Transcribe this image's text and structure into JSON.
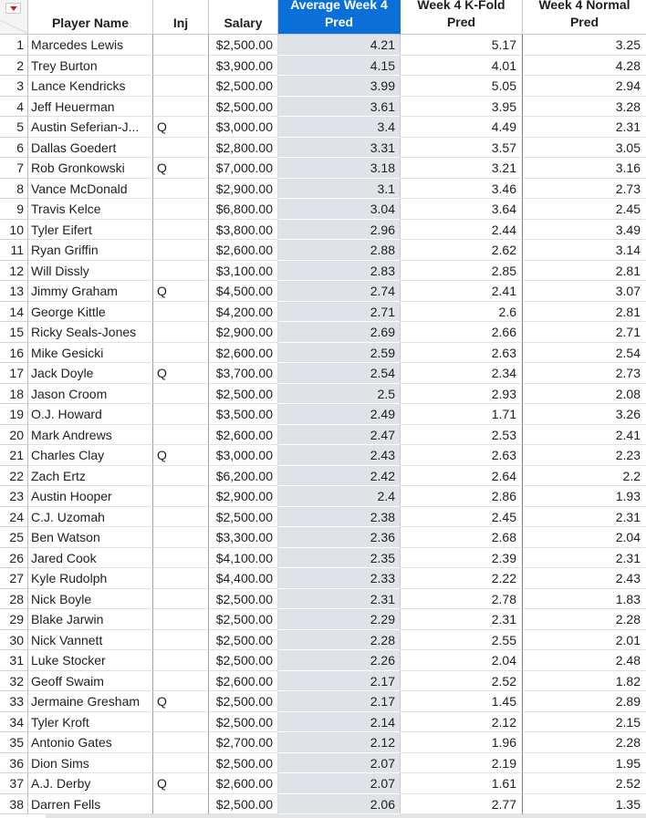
{
  "table": {
    "menu_icon": "red-triangle-menu-icon",
    "columns": [
      {
        "key": "name",
        "label": "Player Name"
      },
      {
        "key": "inj",
        "label": "Inj"
      },
      {
        "key": "salary",
        "label": "Salary"
      },
      {
        "key": "avg",
        "label": "Average Week 4 Pred",
        "selected": true
      },
      {
        "key": "kfold",
        "label": "Week 4 K-Fold Pred"
      },
      {
        "key": "normal",
        "label": "Week 4 Normal Pred"
      }
    ],
    "header_lines": {
      "name": [
        "Player Name"
      ],
      "inj": [
        "Inj"
      ],
      "salary": [
        "Salary"
      ],
      "avg": [
        "Average Week 4",
        "Pred"
      ],
      "kfold": [
        "Week 4 K-Fold",
        "Pred"
      ],
      "normal": [
        "Week 4 Normal",
        "Pred"
      ]
    },
    "selected_column_color": "#0a6fd8",
    "rows": [
      {
        "n": "1",
        "name": "Marcedes Lewis",
        "inj": "",
        "salary": "$2,500.00",
        "avg": "4.21",
        "kfold": "5.17",
        "normal": "3.25"
      },
      {
        "n": "2",
        "name": "Trey Burton",
        "inj": "",
        "salary": "$3,900.00",
        "avg": "4.15",
        "kfold": "4.01",
        "normal": "4.28"
      },
      {
        "n": "3",
        "name": "Lance Kendricks",
        "inj": "",
        "salary": "$2,500.00",
        "avg": "3.99",
        "kfold": "5.05",
        "normal": "2.94"
      },
      {
        "n": "4",
        "name": "Jeff Heuerman",
        "inj": "",
        "salary": "$2,500.00",
        "avg": "3.61",
        "kfold": "3.95",
        "normal": "3.28"
      },
      {
        "n": "5",
        "name": "Austin Seferian-J...",
        "inj": "Q",
        "salary": "$3,000.00",
        "avg": "3.4",
        "kfold": "4.49",
        "normal": "2.31"
      },
      {
        "n": "6",
        "name": "Dallas Goedert",
        "inj": "",
        "salary": "$2,800.00",
        "avg": "3.31",
        "kfold": "3.57",
        "normal": "3.05"
      },
      {
        "n": "7",
        "name": "Rob Gronkowski",
        "inj": "Q",
        "salary": "$7,000.00",
        "avg": "3.18",
        "kfold": "3.21",
        "normal": "3.16"
      },
      {
        "n": "8",
        "name": "Vance McDonald",
        "inj": "",
        "salary": "$2,900.00",
        "avg": "3.1",
        "kfold": "3.46",
        "normal": "2.73"
      },
      {
        "n": "9",
        "name": "Travis Kelce",
        "inj": "",
        "salary": "$6,800.00",
        "avg": "3.04",
        "kfold": "3.64",
        "normal": "2.45"
      },
      {
        "n": "10",
        "name": "Tyler Eifert",
        "inj": "",
        "salary": "$3,800.00",
        "avg": "2.96",
        "kfold": "2.44",
        "normal": "3.49"
      },
      {
        "n": "11",
        "name": "Ryan Griffin",
        "inj": "",
        "salary": "$2,600.00",
        "avg": "2.88",
        "kfold": "2.62",
        "normal": "3.14"
      },
      {
        "n": "12",
        "name": "Will Dissly",
        "inj": "",
        "salary": "$3,100.00",
        "avg": "2.83",
        "kfold": "2.85",
        "normal": "2.81"
      },
      {
        "n": "13",
        "name": "Jimmy Graham",
        "inj": "Q",
        "salary": "$4,500.00",
        "avg": "2.74",
        "kfold": "2.41",
        "normal": "3.07"
      },
      {
        "n": "14",
        "name": "George Kittle",
        "inj": "",
        "salary": "$4,200.00",
        "avg": "2.71",
        "kfold": "2.6",
        "normal": "2.81"
      },
      {
        "n": "15",
        "name": "Ricky Seals-Jones",
        "inj": "",
        "salary": "$2,900.00",
        "avg": "2.69",
        "kfold": "2.66",
        "normal": "2.71"
      },
      {
        "n": "16",
        "name": "Mike Gesicki",
        "inj": "",
        "salary": "$2,600.00",
        "avg": "2.59",
        "kfold": "2.63",
        "normal": "2.54"
      },
      {
        "n": "17",
        "name": "Jack Doyle",
        "inj": "Q",
        "salary": "$3,700.00",
        "avg": "2.54",
        "kfold": "2.34",
        "normal": "2.73"
      },
      {
        "n": "18",
        "name": "Jason Croom",
        "inj": "",
        "salary": "$2,500.00",
        "avg": "2.5",
        "kfold": "2.93",
        "normal": "2.08"
      },
      {
        "n": "19",
        "name": "O.J. Howard",
        "inj": "",
        "salary": "$3,500.00",
        "avg": "2.49",
        "kfold": "1.71",
        "normal": "3.26"
      },
      {
        "n": "20",
        "name": "Mark Andrews",
        "inj": "",
        "salary": "$2,600.00",
        "avg": "2.47",
        "kfold": "2.53",
        "normal": "2.41"
      },
      {
        "n": "21",
        "name": "Charles Clay",
        "inj": "Q",
        "salary": "$3,000.00",
        "avg": "2.43",
        "kfold": "2.63",
        "normal": "2.23"
      },
      {
        "n": "22",
        "name": "Zach Ertz",
        "inj": "",
        "salary": "$6,200.00",
        "avg": "2.42",
        "kfold": "2.64",
        "normal": "2.2"
      },
      {
        "n": "23",
        "name": "Austin Hooper",
        "inj": "",
        "salary": "$2,900.00",
        "avg": "2.4",
        "kfold": "2.86",
        "normal": "1.93"
      },
      {
        "n": "24",
        "name": "C.J. Uzomah",
        "inj": "",
        "salary": "$2,500.00",
        "avg": "2.38",
        "kfold": "2.45",
        "normal": "2.31"
      },
      {
        "n": "25",
        "name": "Ben Watson",
        "inj": "",
        "salary": "$3,300.00",
        "avg": "2.36",
        "kfold": "2.68",
        "normal": "2.04"
      },
      {
        "n": "26",
        "name": "Jared Cook",
        "inj": "",
        "salary": "$4,100.00",
        "avg": "2.35",
        "kfold": "2.39",
        "normal": "2.31"
      },
      {
        "n": "27",
        "name": "Kyle Rudolph",
        "inj": "",
        "salary": "$4,400.00",
        "avg": "2.33",
        "kfold": "2.22",
        "normal": "2.43"
      },
      {
        "n": "28",
        "name": "Nick Boyle",
        "inj": "",
        "salary": "$2,500.00",
        "avg": "2.31",
        "kfold": "2.78",
        "normal": "1.83"
      },
      {
        "n": "29",
        "name": "Blake Jarwin",
        "inj": "",
        "salary": "$2,500.00",
        "avg": "2.29",
        "kfold": "2.31",
        "normal": "2.28"
      },
      {
        "n": "30",
        "name": "Nick Vannett",
        "inj": "",
        "salary": "$2,500.00",
        "avg": "2.28",
        "kfold": "2.55",
        "normal": "2.01"
      },
      {
        "n": "31",
        "name": "Luke Stocker",
        "inj": "",
        "salary": "$2,500.00",
        "avg": "2.26",
        "kfold": "2.04",
        "normal": "2.48"
      },
      {
        "n": "32",
        "name": "Geoff Swaim",
        "inj": "",
        "salary": "$2,600.00",
        "avg": "2.17",
        "kfold": "2.52",
        "normal": "1.82"
      },
      {
        "n": "33",
        "name": "Jermaine Gresham",
        "inj": "Q",
        "salary": "$2,500.00",
        "avg": "2.17",
        "kfold": "1.45",
        "normal": "2.89"
      },
      {
        "n": "34",
        "name": "Tyler Kroft",
        "inj": "",
        "salary": "$2,500.00",
        "avg": "2.14",
        "kfold": "2.12",
        "normal": "2.15"
      },
      {
        "n": "35",
        "name": "Antonio Gates",
        "inj": "",
        "salary": "$2,700.00",
        "avg": "2.12",
        "kfold": "1.96",
        "normal": "2.28"
      },
      {
        "n": "36",
        "name": "Dion Sims",
        "inj": "",
        "salary": "$2,500.00",
        "avg": "2.07",
        "kfold": "2.19",
        "normal": "1.95"
      },
      {
        "n": "37",
        "name": "A.J. Derby",
        "inj": "Q",
        "salary": "$2,600.00",
        "avg": "2.07",
        "kfold": "1.61",
        "normal": "2.52"
      },
      {
        "n": "38",
        "name": "Darren Fells",
        "inj": "",
        "salary": "$2,500.00",
        "avg": "2.06",
        "kfold": "2.77",
        "normal": "1.35"
      }
    ]
  }
}
